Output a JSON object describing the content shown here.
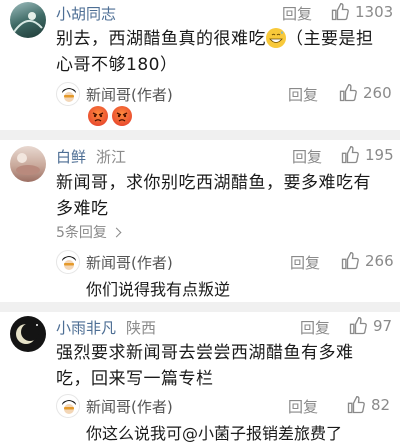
{
  "comments": [
    {
      "user": "小胡同志",
      "location": "",
      "reply_label": "回复",
      "likes": "1303",
      "text_line1": "别去，西湖醋鱼真的很难吃",
      "text_line1_after": "（主要是担",
      "text_line2": "心哥不够180）",
      "author_reply": {
        "name": "新闻哥(作者)",
        "reply_label": "回复",
        "likes": "260",
        "text": ""
      }
    },
    {
      "user": "白鲜",
      "location": "浙江",
      "reply_label": "回复",
      "likes": "195",
      "text_line1": "新闻哥，求你别吃西湖醋鱼，要多难吃有",
      "text_line2": "多难吃",
      "more_replies": "5条回复",
      "author_reply": {
        "name": "新闻哥(作者)",
        "reply_label": "回复",
        "likes": "266",
        "text": "你们说得我有点叛逆"
      }
    },
    {
      "user": "小雨非凡",
      "location": "陕西",
      "reply_label": "回复",
      "likes": "97",
      "text_line1": "强烈要求新闻哥去尝尝西湖醋鱼有多难",
      "text_line2": "吃，回来写一篇专栏",
      "author_reply": {
        "name": "新闻哥(作者)",
        "reply_label": "回复",
        "likes": "82",
        "text": "你这么说我可@小菌子报销差旅费了"
      }
    }
  ],
  "icons": {
    "like": "thumbs-up-icon",
    "grin": "grinning-sweat-emoji",
    "angry": "angry-face-emoji",
    "chevron": "chevron-right-icon"
  }
}
